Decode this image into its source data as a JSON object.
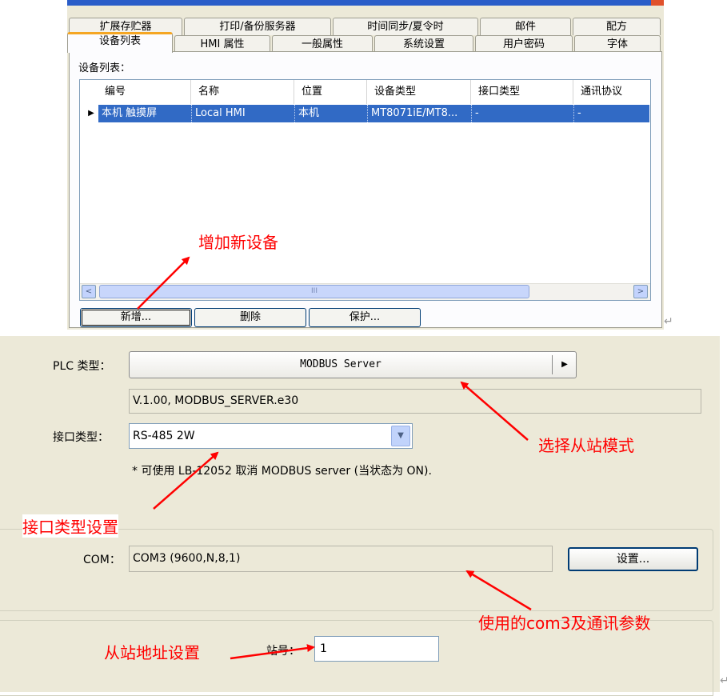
{
  "top_dialog": {
    "tabs_row1": [
      "扩展存贮器",
      "打印/备份服务器",
      "时间同步/夏令时",
      "邮件",
      "配方"
    ],
    "tabs_row2": [
      "设备列表",
      "HMI 属性",
      "一般属性",
      "系统设置",
      "用户密码",
      "字体"
    ],
    "list_label": "设备列表：",
    "columns": [
      "编号",
      "名称",
      "位置",
      "设备类型",
      "接口类型",
      "通讯协议"
    ],
    "rows": [
      [
        "本机 触摸屏",
        "Local HMI",
        "本机",
        "MT8071iE/MT8...",
        "-",
        "-"
      ]
    ],
    "row_indicator": "▶",
    "buttons": {
      "add": "新增...",
      "delete": "删除",
      "protect": "保护..."
    },
    "scrollbar": {
      "left": "<",
      "right": ">",
      "thumb": "III"
    }
  },
  "paragraph_marks": [
    "↵",
    "↵"
  ],
  "bottom_dialog": {
    "plc_type_label": "PLC 类型：",
    "plc_type_value": "MODBUS Server",
    "plc_arrow": "▶",
    "version": "V.1.00, MODBUS_SERVER.e30",
    "interface_label": "接口类型：",
    "interface_value": "RS-485 2W",
    "interface_dropdown": "▼",
    "note": "* 可使用 LB-12052 取消 MODBUS server (当状态为 ON).",
    "com_label": "COM：",
    "com_value": "COM3 (9600,N,8,1)",
    "com_settings_button": "设置...",
    "station_label": "站号：",
    "station_value": "1"
  },
  "annotations": {
    "add_device": "增加新设备",
    "select_slave": "选择从站模式",
    "interface_setting": "接口类型设置",
    "com_params": "使用的com3及通讯参数",
    "slave_address": "从站地址设置",
    "color": "#FF0000"
  }
}
